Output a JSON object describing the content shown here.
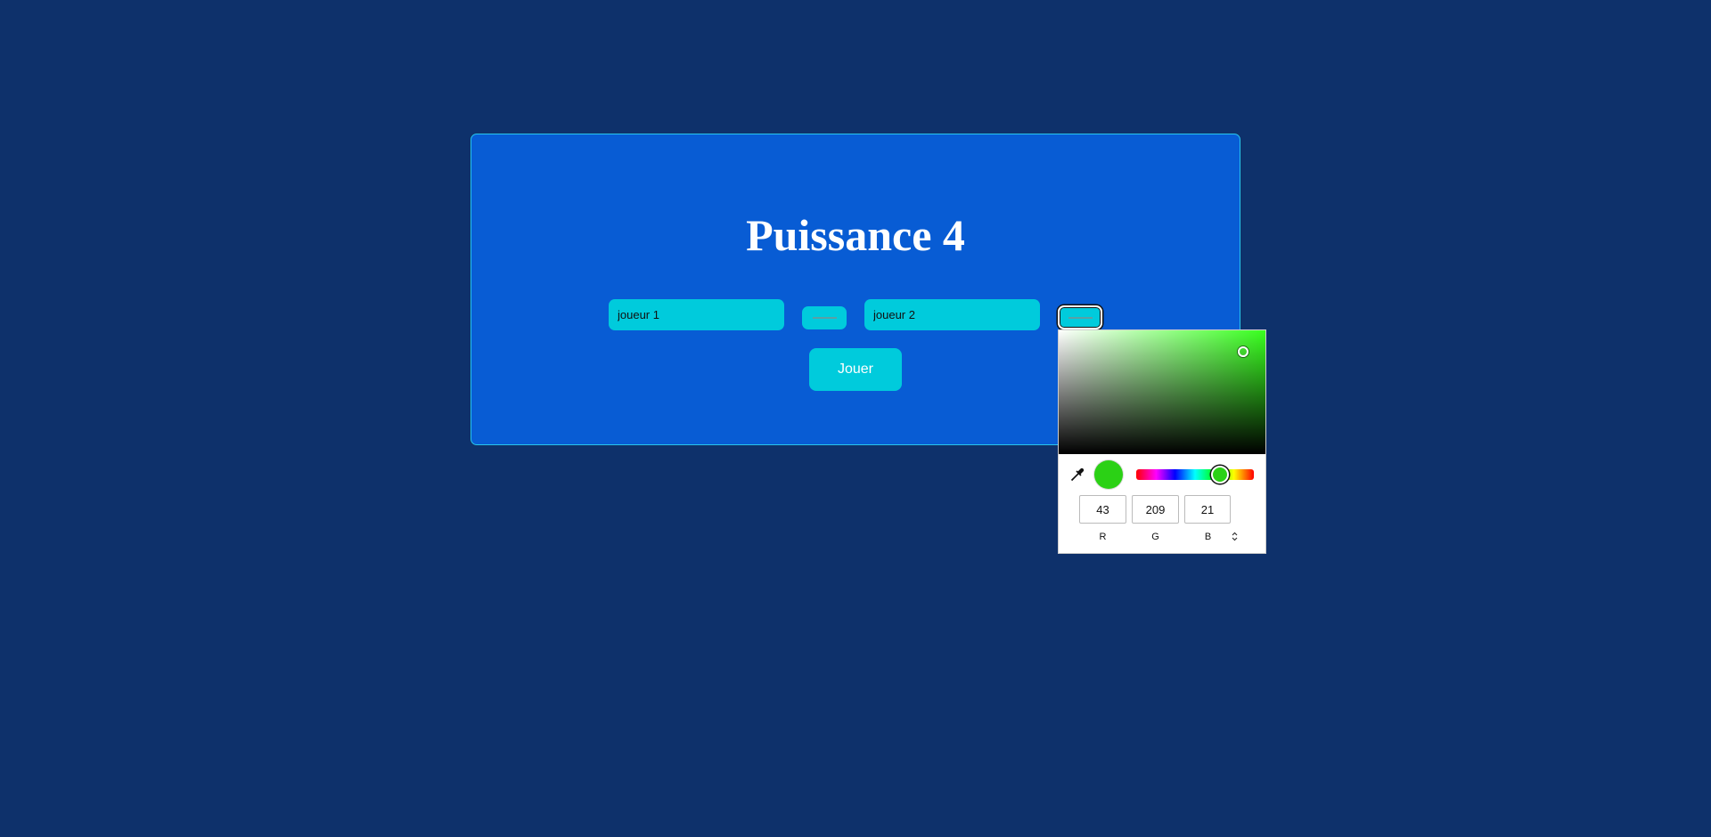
{
  "game": {
    "title": "Puissance 4",
    "player1": {
      "name": "joueur 1"
    },
    "player2": {
      "name": "joueur 2"
    },
    "play_label": "Jouer"
  },
  "color_picker": {
    "current_hex": "#2bd115",
    "r": "43",
    "g": "209",
    "b": "21",
    "r_label": "R",
    "g_label": "G",
    "b_label": "B",
    "mode_toggle_icon": "up-down-chevron-icon",
    "eyedropper_icon": "eyedropper-icon"
  },
  "colors": {
    "page_background": "#0e316b",
    "card_background": "#085cd4",
    "accent": "#00cbdc",
    "card_border": "#28c6ec"
  }
}
